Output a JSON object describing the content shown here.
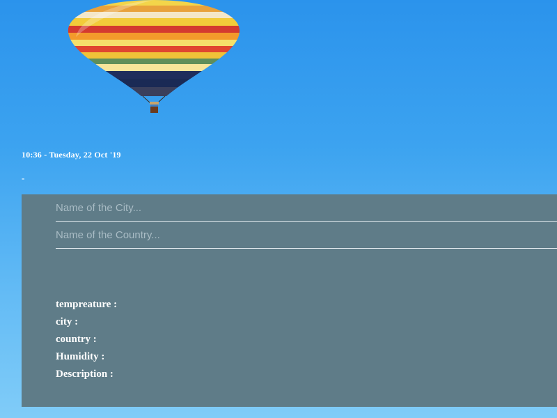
{
  "datetime": "10:36 - Tuesday, 22 Oct '19",
  "location_line": "-",
  "form": {
    "city_placeholder": "Name of the City...",
    "country_placeholder": "Name of the Country..."
  },
  "info": [
    {
      "label": "tempreature :"
    },
    {
      "label": "city :"
    },
    {
      "label": "country :"
    },
    {
      "label": "Humidity :"
    },
    {
      "label": "Description :"
    }
  ],
  "illustration": {
    "icon": "hot-air-balloon-icon"
  }
}
